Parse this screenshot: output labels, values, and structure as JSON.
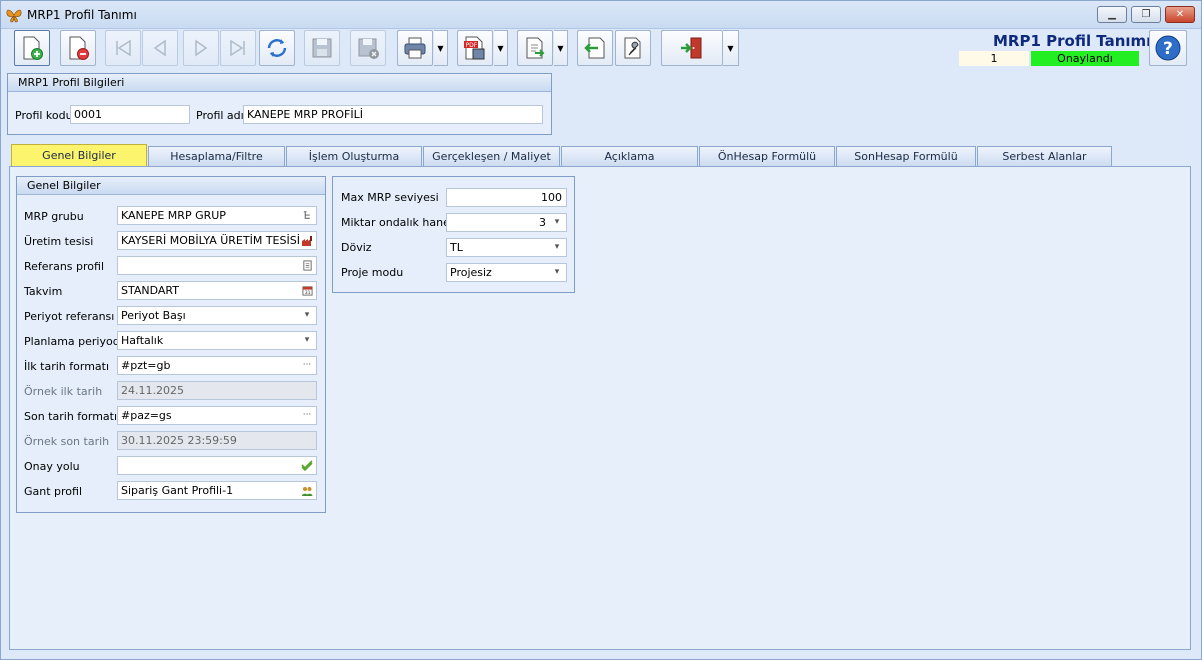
{
  "window": {
    "title": "MRP1 Profil Tanımı"
  },
  "header": {
    "screen_title": "MRP1 Profil Tanımı",
    "record_no": "1",
    "status": "Onaylandı",
    "status_color": "#22ee22"
  },
  "toolbar": {
    "buttons": [
      {
        "name": "new-record",
        "icon": "new-document-icon",
        "enabled": true
      },
      {
        "name": "delete-record",
        "icon": "delete-document-icon",
        "enabled": true
      },
      {
        "name": "first-record",
        "icon": "first-icon",
        "enabled": false
      },
      {
        "name": "previous-record",
        "icon": "previous-icon",
        "enabled": false
      },
      {
        "name": "next-record",
        "icon": "next-icon",
        "enabled": false
      },
      {
        "name": "last-record",
        "icon": "last-icon",
        "enabled": false
      },
      {
        "name": "refresh",
        "icon": "refresh-icon",
        "enabled": true
      },
      {
        "name": "save",
        "icon": "save-icon",
        "enabled": false
      },
      {
        "name": "save-close",
        "icon": "save-close-icon",
        "enabled": false
      },
      {
        "name": "print",
        "icon": "print-icon",
        "enabled": true
      },
      {
        "name": "export-pdf",
        "icon": "pdf-icon",
        "enabled": true
      },
      {
        "name": "export",
        "icon": "export-icon",
        "enabled": true
      },
      {
        "name": "import",
        "icon": "import-icon",
        "enabled": true
      },
      {
        "name": "settings",
        "icon": "wrench-icon",
        "enabled": true
      },
      {
        "name": "exit",
        "icon": "exit-door-icon",
        "enabled": true
      }
    ]
  },
  "profile_info": {
    "header": "MRP1 Profil Bilgileri",
    "code_label": "Profil kodu",
    "code_value": "0001",
    "name_label": "Profil adı",
    "name_value": "KANEPE MRP PROFİLİ"
  },
  "tabs": [
    {
      "label": "Genel Bilgiler",
      "active": true
    },
    {
      "label": "Hesaplama/Filtre",
      "active": false
    },
    {
      "label": "İşlem Oluşturma",
      "active": false
    },
    {
      "label": "Gerçekleşen / Maliyet",
      "active": false
    },
    {
      "label": "Açıklama",
      "active": false
    },
    {
      "label": "ÖnHesap Formülü",
      "active": false
    },
    {
      "label": "SonHesap Formülü",
      "active": false
    },
    {
      "label": "Serbest Alanlar",
      "active": false
    }
  ],
  "general": {
    "header": "Genel Bilgiler",
    "fields": [
      {
        "label": "MRP grubu",
        "value": "KANEPE MRP GRUP",
        "icon": "tree-picker-icon",
        "readonly": false
      },
      {
        "label": "Üretim tesisi",
        "value": "KAYSERİ MOBİLYA ÜRETİM TESİSİ",
        "icon": "factory-icon",
        "readonly": false
      },
      {
        "label": "Referans profil",
        "value": "",
        "icon": "list-picker-icon",
        "readonly": false
      },
      {
        "label": "Takvim",
        "value": "STANDART",
        "icon": "calendar-icon",
        "readonly": false
      },
      {
        "label": "Periyot referansı",
        "value": "Periyot Başı",
        "icon": "dropdown-icon",
        "readonly": false
      },
      {
        "label": "Planlama periyodu",
        "value": "Haftalık",
        "icon": "dropdown-icon",
        "readonly": false
      },
      {
        "label": "İlk tarih formatı",
        "value": "#pzt=gb",
        "icon": "ellipsis-icon",
        "readonly": false
      },
      {
        "label": "Örnek ilk tarih",
        "value": "24.11.2025",
        "icon": "",
        "readonly": true
      },
      {
        "label": "Son tarih formatı",
        "value": "#paz=gs",
        "icon": "ellipsis-icon",
        "readonly": false
      },
      {
        "label": "Örnek son tarih",
        "value": "30.11.2025 23:59:59",
        "icon": "",
        "readonly": true
      },
      {
        "label": "Onay yolu",
        "value": "",
        "icon": "approval-check-icon",
        "readonly": false
      },
      {
        "label": "Gant profil",
        "value": "Sipariş Gant Profili-1",
        "icon": "users-icon",
        "readonly": false
      }
    ]
  },
  "mrp_settings": {
    "fields": [
      {
        "label": "Max MRP seviyesi",
        "value": "100",
        "type": "number"
      },
      {
        "label": "Miktar ondalık hanesi",
        "value": "3",
        "type": "number-combo"
      },
      {
        "label": "Döviz",
        "value": "TL",
        "type": "combo"
      },
      {
        "label": "Proje modu",
        "value": "Projesiz",
        "type": "combo"
      }
    ]
  }
}
